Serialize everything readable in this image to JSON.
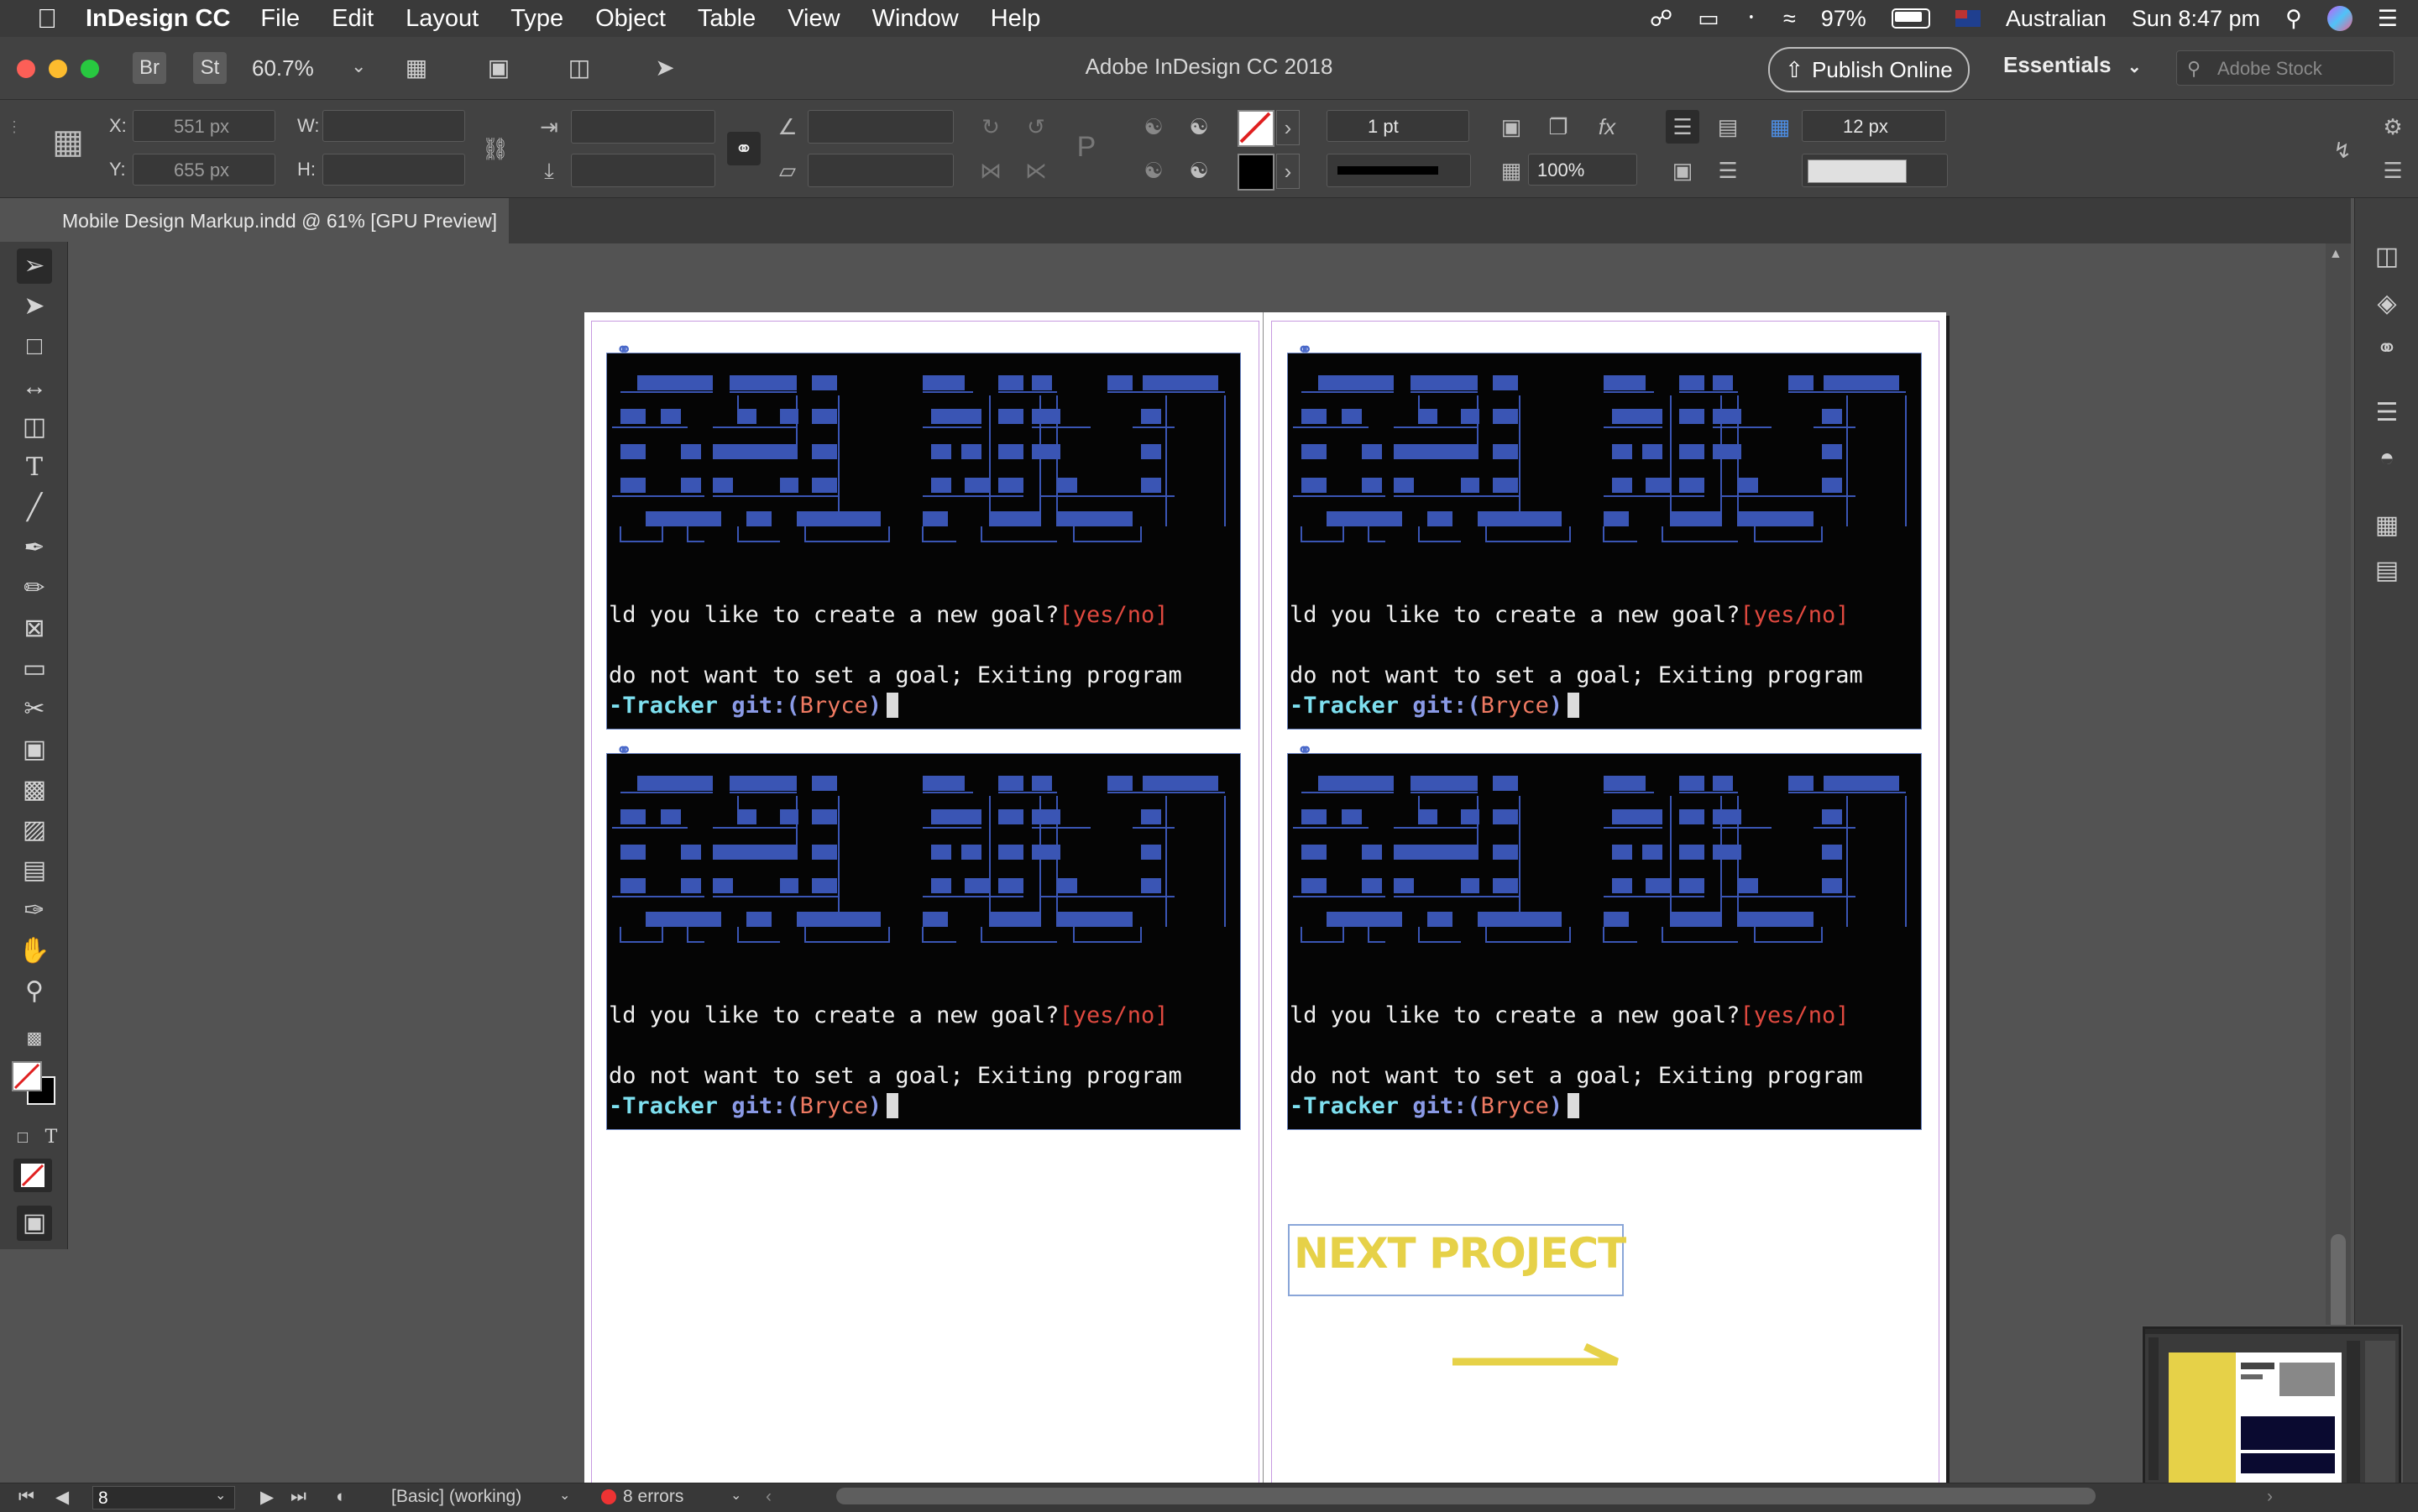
{
  "menubar": {
    "app_name": "InDesign CC",
    "menus": [
      "File",
      "Edit",
      "Layout",
      "Type",
      "Object",
      "Table",
      "View",
      "Window",
      "Help"
    ],
    "battery": "97%",
    "input_source": "Australian",
    "clock": "Sun 8:47 pm"
  },
  "titlebar": {
    "bridge_label": "Br",
    "stock_label": "St",
    "zoom": "60.7%",
    "title": "Adobe InDesign CC 2018",
    "publish_label": "Publish Online",
    "workspace": "Essentials",
    "stock_search_placeholder": "Adobe Stock"
  },
  "control": {
    "x_label": "X:",
    "x_value": "551 px",
    "y_label": "Y:",
    "y_value": "655 px",
    "w_label": "W:",
    "h_label": "H:",
    "stroke_weight": "1 pt",
    "opacity": "100%",
    "gutter": "12 px"
  },
  "tab": {
    "title": "Mobile Design Markup.indd @ 61% [GPU Preview]"
  },
  "terminal": {
    "prompt_question": "ld you like to create a new goal?",
    "prompt_options": "[yes/no]",
    "exit_message": "do not want to set a goal; Exiting program",
    "dir": "-Tracker",
    "git_label": "git:(",
    "branch": "Bryce",
    "git_close": ")"
  },
  "page": {
    "next_project": "NEXT PROJECT"
  },
  "statusbar": {
    "page_number": "8",
    "preflight_profile": "[Basic] (working)",
    "errors": "8 errors"
  },
  "colors": {
    "accent_yellow": "#e6d148",
    "ascii_blue": "#3a55b4",
    "error_red": "#e33333"
  }
}
